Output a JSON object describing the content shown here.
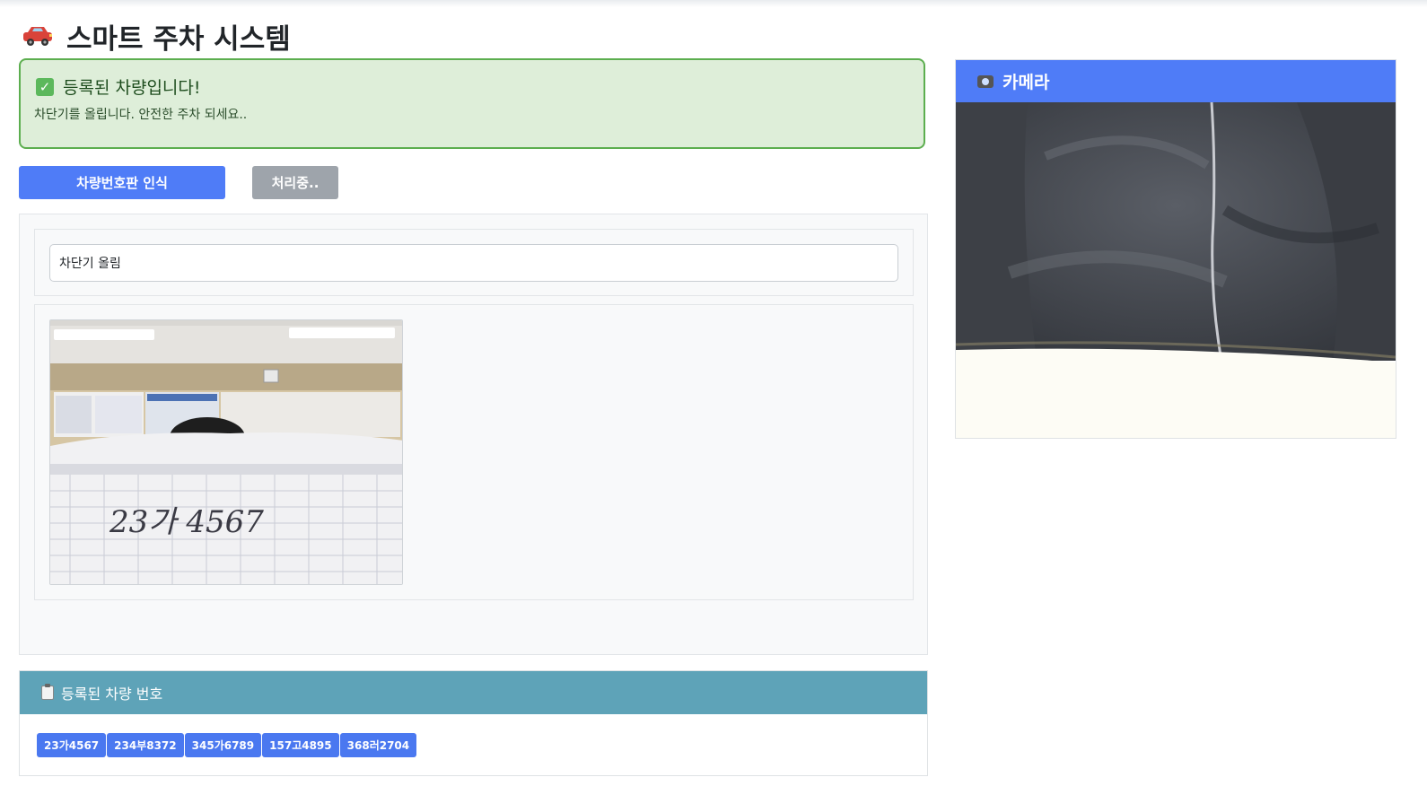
{
  "header": {
    "title": "스마트 주차 시스템",
    "icon": "car-icon"
  },
  "alert": {
    "title": "등록된 차량입니다!",
    "message": "차단기를 올립니다. 안전한 주차 되세요..",
    "icon": "check-icon",
    "bg_color": "#deeed9",
    "border_color": "#5cae4f"
  },
  "buttons": {
    "recognize_label": "차량번호판 인식",
    "processing_label": "처리중.."
  },
  "status": {
    "value": "차단기 올림"
  },
  "captured_image": {
    "handwritten_text": "23가 4567"
  },
  "registered": {
    "title": "등록된 차량 번호",
    "icon": "clipboard-icon",
    "plates": [
      "23가4567",
      "234부8372",
      "345가6789",
      "157고4895",
      "368러2704"
    ]
  },
  "camera": {
    "title": "카메라",
    "icon": "camera-icon"
  },
  "colors": {
    "primary": "#4f7cf7",
    "info": "#5ea3b8",
    "secondary": "#9ea4ab",
    "success": "#5cae4f"
  }
}
